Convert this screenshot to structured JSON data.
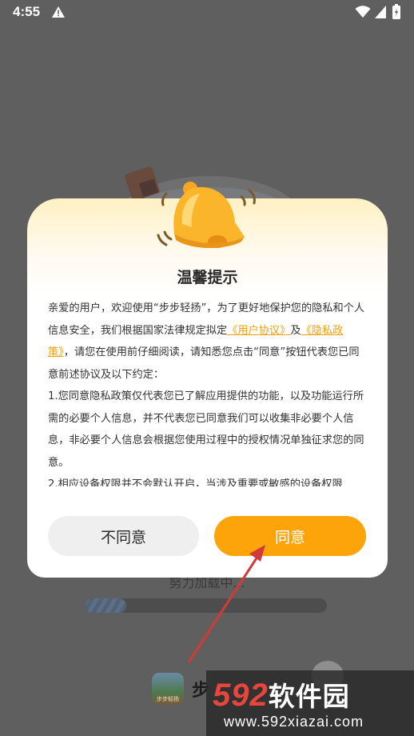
{
  "status_bar": {
    "time": "4:55"
  },
  "background": {
    "loading_text": "努力加载中...",
    "progress": 0.17,
    "app_icon_label": "步步轻扬",
    "app_name_partial": "步"
  },
  "dialog": {
    "title": "温馨提示",
    "body": {
      "intro_prefix": "亲爱的用户，欢迎使用“步步轻扬”，为了更好地保护您的隐私和个人信息安全，我们根据国家法律规定拟定",
      "link_user_agreement": "《用户协议》",
      "and": "及",
      "link_privacy": "《隐私政策》",
      "intro_suffix": "，请您在使用前仔细阅读，请知悉您点击“同意”按钮代表您已同意前述协议及以下约定：",
      "clause1": "1.您同意隐私政策仅代表您已了解应用提供的功能，以及功能运行所需的必要个人信息，并不代表您已同意我们可以收集非必要个人信息，非必要个人信息会根据您使用过程中的授权情况单独征求您的同意。",
      "clause2": "2.相应设备权限并不会默认开启，当涉及重要或敏感的设备权限"
    },
    "disagree_label": "不同意",
    "agree_label": "同意"
  },
  "watermark": {
    "logo_num": "592",
    "logo_text": "软件园",
    "url": "www.592xiazai.com"
  },
  "colors": {
    "accent": "#fca40a",
    "link": "#f2a00e",
    "arrow": "#d23a3a"
  }
}
